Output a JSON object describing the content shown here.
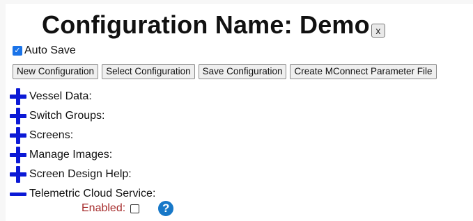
{
  "header": {
    "title": "Configuration Name: Demo",
    "close_label": "x"
  },
  "autosave": {
    "label": "Auto Save",
    "checked": true
  },
  "toolbar": {
    "new_label": "New Configuration",
    "select_label": "Select Configuration",
    "save_label": "Save Configuration",
    "mconnect_label": "Create MConnect Parameter File"
  },
  "sections": [
    {
      "label": "Vessel Data:",
      "icon": "plus-icon"
    },
    {
      "label": "Switch Groups:",
      "icon": "plus-icon"
    },
    {
      "label": "Screens:",
      "icon": "plus-icon"
    },
    {
      "label": "Manage Images:",
      "icon": "plus-icon"
    },
    {
      "label": "Screen Design Help:",
      "icon": "plus-icon"
    },
    {
      "label": "Telemetric Cloud Service:",
      "icon": "minus-icon"
    }
  ],
  "telemetric": {
    "enabled_label": "Enabled:",
    "enabled_checked": false,
    "help_glyph": "?"
  },
  "colors": {
    "icon_blue": "#0b19d6",
    "enabled_red": "#a52a2a",
    "help_blue": "#1778c8",
    "checkbox_blue": "#1a73e8"
  }
}
